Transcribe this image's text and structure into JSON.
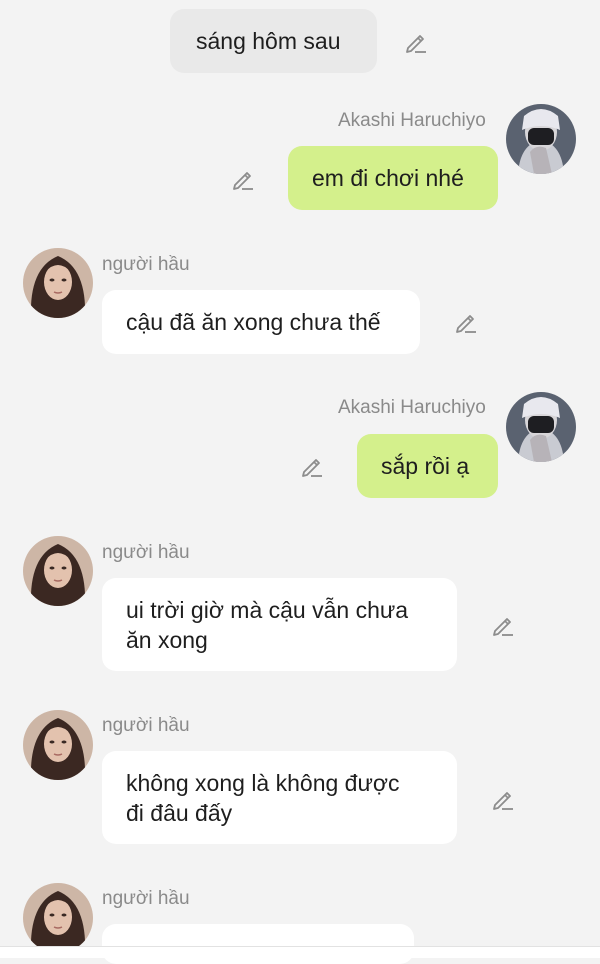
{
  "system_note": {
    "text": "sáng hôm sau"
  },
  "messages": [
    {
      "sender": "Akashi Haruchiyo",
      "text": "em đi chơi nhé",
      "side": "right"
    },
    {
      "sender": "người hầu",
      "text": "cậu đã ăn xong chưa thế",
      "side": "left"
    },
    {
      "sender": "Akashi Haruchiyo",
      "text": "sắp rồi ạ",
      "side": "right"
    },
    {
      "sender": "người hầu",
      "lines": [
        "ui trời giờ mà cậu vẫn chưa",
        "ăn xong"
      ],
      "side": "left"
    },
    {
      "sender": "người hầu",
      "lines": [
        "không xong là không được",
        "đi đâu đấy"
      ],
      "side": "left"
    },
    {
      "sender": "người hầu",
      "side": "left"
    }
  ],
  "icons": {
    "edit": "pencil-edit-icon",
    "avatar_right": "avatar-akashi",
    "avatar_left": "avatar-nguoi-hau"
  },
  "colors": {
    "background": "#f3f3f3",
    "bubble_right": "#d4f08c",
    "bubble_left": "#ffffff",
    "system_bubble": "#e9e9e9",
    "name": "#8a8a8a"
  }
}
